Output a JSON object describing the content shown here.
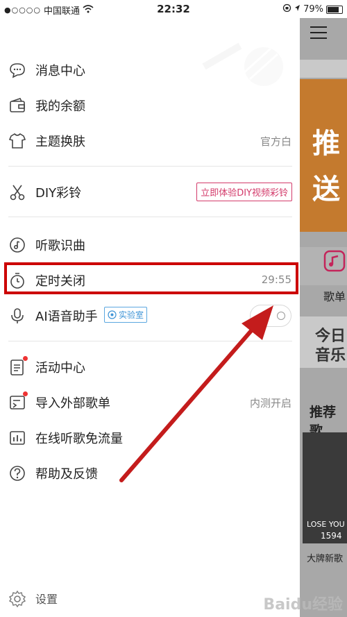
{
  "status": {
    "carrier": "中国联通",
    "time": "22:32",
    "battery": "79%",
    "battery_level": 0.79
  },
  "menu": {
    "messages": "消息中心",
    "balance": "我的余额",
    "theme": "主题换肤",
    "theme_value": "官方白",
    "diy": "DIY彩铃",
    "diy_badge": "立即体验DIY视频彩铃",
    "recognize": "听歌识曲",
    "timer": "定时关闭",
    "timer_value": "29:55",
    "ai": "AI语音助手",
    "ai_badge": "实验室",
    "ai_enabled": false,
    "activity": "活动中心",
    "import": "导入外部歌单",
    "import_value": "内测开启",
    "free_flow": "在线听歌免流量",
    "help": "帮助及反馈",
    "settings": "设置"
  },
  "background": {
    "banner_text_1": "推",
    "banner_text_2": "送",
    "playlist_label": "歌单",
    "today_text_1": "今日",
    "today_text_2": "音乐",
    "recommend": "推荐歌",
    "album_text": "LOSE YOU",
    "album_count": "1594",
    "album_caption": "大牌新歌"
  },
  "watermark": "Baidu经验",
  "colors": {
    "highlight": "#cc0000",
    "arrow": "#c41c1c",
    "badge_pink": "#d33a6a",
    "badge_blue": "#3f94d6"
  }
}
